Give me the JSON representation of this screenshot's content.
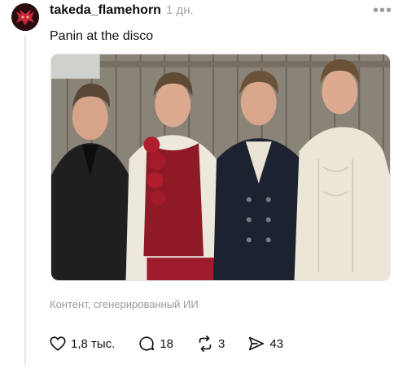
{
  "post": {
    "username": "takeda_flamehorn",
    "time": "1 дн.",
    "more_icon": "•••",
    "text": "Panin at the disco",
    "image_alt": "Four men in Victorian-style costumes standing in front of a wooden fence",
    "ai_label": "Контент, сгенерированный ИИ"
  },
  "actions": {
    "likes": "1,8 тыс.",
    "comments": "18",
    "reposts": "3",
    "shares": "43"
  },
  "colors": {
    "avatar_bg": "#2a0d0f",
    "avatar_accent": "#c8283a",
    "muted_text": "#a6a6a6"
  }
}
